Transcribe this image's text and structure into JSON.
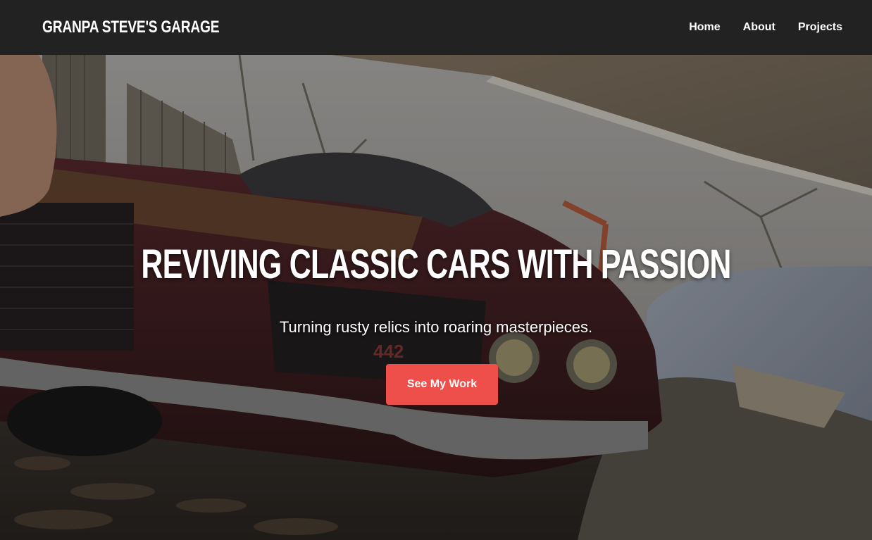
{
  "brand": {
    "name": "GRANPA STEVE'S GARAGE"
  },
  "nav": {
    "links": [
      {
        "label": "Home"
      },
      {
        "label": "About"
      },
      {
        "label": "Projects"
      }
    ]
  },
  "hero": {
    "title": "REVIVING CLASSIC CARS WITH PASSION",
    "subtitle": "Turning rusty relics into roaring masterpieces.",
    "cta_label": "See My Work",
    "badge_text": "442"
  },
  "colors": {
    "navbar_bg": "#222222",
    "cta_bg": "#ee4f4b",
    "text": "#ffffff"
  }
}
